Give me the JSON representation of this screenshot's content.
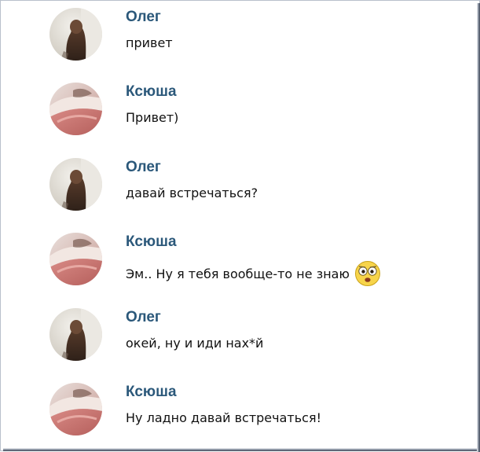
{
  "messages": [
    {
      "name": "Олег",
      "text": "привет",
      "avatar": "oleg"
    },
    {
      "name": "Ксюша",
      "text": "Привет)",
      "avatar": "ksyusha"
    },
    {
      "name": "Олег",
      "text": "давай встречаться?",
      "avatar": "oleg"
    },
    {
      "name": "Ксюша",
      "text": "Эм.. Ну я тебя вообще-то не знаю",
      "avatar": "ksyusha",
      "emoji": "flushed-face-icon"
    },
    {
      "name": "Олег",
      "text": "окей, ну и иди нах*й",
      "avatar": "oleg"
    },
    {
      "name": "Ксюша",
      "text": "Ну ладно давай встречаться!",
      "avatar": "ksyusha"
    }
  ],
  "colors": {
    "name": "#2b587a",
    "text": "#111111",
    "frame": "#b9c0cc"
  }
}
